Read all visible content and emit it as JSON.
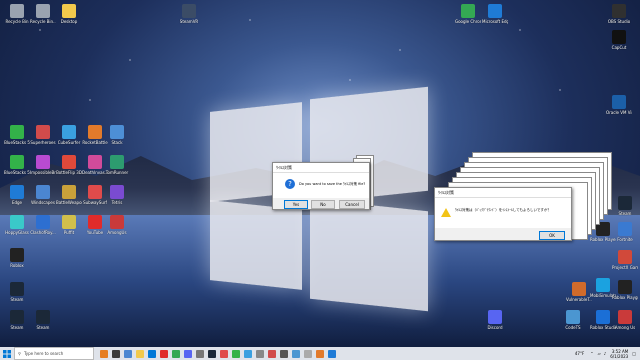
{
  "desktop": {
    "icons": [
      {
        "label": "Recycle Bin",
        "color": "#9aa3b0"
      },
      {
        "label": "Recycle Bin...",
        "color": "#9aa3b0"
      },
      {
        "label": "Desktop",
        "color": "#f2c94c"
      },
      {
        "label": "SteamVR",
        "color": "#3b4c66"
      },
      {
        "label": "Google Chrome",
        "color": "#34a853"
      },
      {
        "label": "Microsoft Edge",
        "color": "#1f7bd6"
      },
      {
        "label": "OBS Studio",
        "color": "#303030"
      },
      {
        "label": "CapCut",
        "color": "#111111"
      },
      {
        "label": "Oracle VM VirtualBox",
        "color": "#1b5fa8"
      },
      {
        "label": "BlueStacks 5",
        "color": "#33b249"
      },
      {
        "label": "Superheroes",
        "color": "#d14b4b"
      },
      {
        "label": "CubeSurfer",
        "color": "#3aa0e0"
      },
      {
        "label": "RocketBattle",
        "color": "#e27a2b"
      },
      {
        "label": "Stack",
        "color": "#4d8fd6"
      },
      {
        "label": "BlueStacks 5 App Player",
        "color": "#33b249"
      },
      {
        "label": "ImpossibleBr...",
        "color": "#b84bd1"
      },
      {
        "label": "BottleFlip 3D",
        "color": "#e0493a"
      },
      {
        "label": "DeathInvas...",
        "color": "#d14b9a"
      },
      {
        "label": "TomRunner",
        "color": "#2d9c6f"
      },
      {
        "label": "Edge",
        "color": "#1f7bd6"
      },
      {
        "label": "Windscapes",
        "color": "#4b86d1"
      },
      {
        "label": "BattleWeapon",
        "color": "#c9a13a"
      },
      {
        "label": "SubwaySurf",
        "color": "#e04b4b"
      },
      {
        "label": "Tetris",
        "color": "#7a4bd1"
      },
      {
        "label": "HoppyGlass",
        "color": "#3ac9c9"
      },
      {
        "label": "ClashofRoy...",
        "color": "#2d6fd1"
      },
      {
        "label": "Puffit",
        "color": "#d1bf4b"
      },
      {
        "label": "YouTube",
        "color": "#e02b2b"
      },
      {
        "label": "AmongUs",
        "color": "#c93a3a"
      },
      {
        "label": "Roblox",
        "color": "#222222"
      },
      {
        "label": "Roblox Player",
        "color": "#222222"
      },
      {
        "label": "Fortnite",
        "color": "#3a7ad1"
      },
      {
        "label": "ProjectX Gamer",
        "color": "#d1493a"
      },
      {
        "label": "MobiSimulator",
        "color": "#1ba2e0"
      },
      {
        "label": "Steam",
        "color": "#1b2838"
      },
      {
        "label": "Discord",
        "color": "#5865f2"
      },
      {
        "label": "Steam",
        "color": "#1b2838"
      },
      {
        "label": "CodeTS",
        "color": "#4b96d1"
      },
      {
        "label": "Roblox Playground",
        "color": "#222222"
      },
      {
        "label": "VulnerableT...",
        "color": "#d16b2b"
      },
      {
        "label": "Roblox Studio",
        "color": "#1b6fd6"
      },
      {
        "label": "Among Us",
        "color": "#c93a3a"
      },
      {
        "label": "Steam",
        "color": "#1b2838"
      },
      {
        "label": "Steam",
        "color": "#1b2838"
      }
    ]
  },
  "dialog_question": {
    "title": "ｳｲﾙｽ対策",
    "message": "Do you want to save the ｳｲﾙｽ対策 file?",
    "yes_label": "Yes",
    "no_label": "No",
    "cancel_label": "Cancel"
  },
  "dialog_warning": {
    "title": "ｳｲﾙｽ対策",
    "message": "ｳｲﾙｽ対策は（ﾊﾞｯｸｸﾞﾗｳﾝﾄﾞ）をｲﾝｽﾄｰﾙしてもよろしいですか？",
    "ok_label": "OK"
  },
  "taskbar": {
    "search_placeholder": "Type here to search",
    "weather": "47°F",
    "time": "3:52 AM",
    "date": "6/1/2023",
    "pinned_colors": [
      "#e67e22",
      "#3a3a3a",
      "#4b86d1",
      "#f2c94c",
      "#0078d7",
      "#e02b2b",
      "#34a853",
      "#5865f2",
      "#777777",
      "#1b2838",
      "#e04b4b",
      "#33b249",
      "#3aa0e0",
      "#888888",
      "#d14b4b",
      "#555555",
      "#4b96d1",
      "#aaaaaa",
      "#e27a2b",
      "#1f7bd6"
    ]
  }
}
